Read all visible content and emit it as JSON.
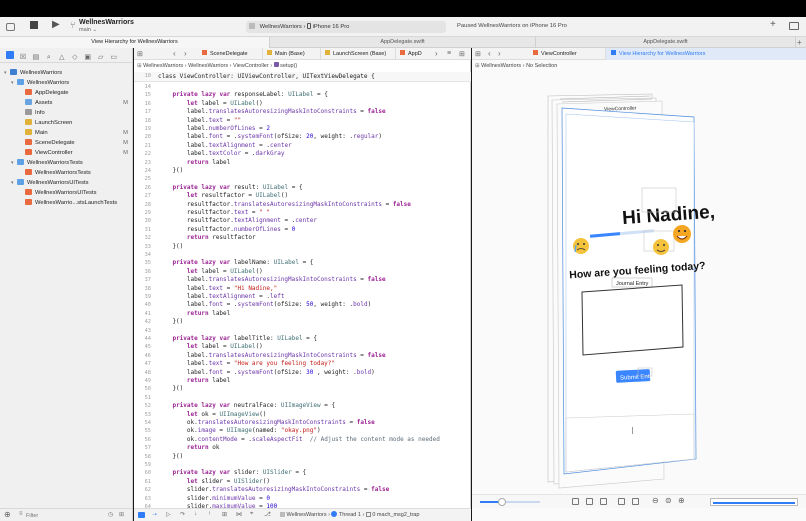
{
  "window": {
    "project_name": "WellnesWarriors",
    "branch": "main",
    "scheme": "WellnesWarriors",
    "device": "iPhone 16 Pro",
    "status": "Paused WellnesWarriors on iPhone 16 Pro"
  },
  "tabs": [
    {
      "label": "View Hierarchy for WellnesWarriors",
      "active": true
    },
    {
      "label": "AppDelegate.swift",
      "active": false
    },
    {
      "label": "AppDelegate.swift",
      "active": false
    }
  ],
  "editor_tabs": [
    "SceneDelegate",
    "Main (Base)",
    "LaunchScreen (Base)",
    "AppD"
  ],
  "canvas_tabs": [
    "ViewController",
    "View Hierarchy for WellnesWarriors"
  ],
  "navigator": {
    "items": [
      {
        "label": "WellnesWarriors",
        "level": 0,
        "kind": "proj",
        "badge": ""
      },
      {
        "label": "WellnesWarriors",
        "level": 1,
        "kind": "folder",
        "badge": ""
      },
      {
        "label": "AppDelegate",
        "level": 2,
        "kind": "swift",
        "badge": ""
      },
      {
        "label": "Assets",
        "level": 2,
        "kind": "asset",
        "badge": "M"
      },
      {
        "label": "Info",
        "level": 2,
        "kind": "plist",
        "badge": ""
      },
      {
        "label": "LaunchScreen",
        "level": 2,
        "kind": "story",
        "badge": ""
      },
      {
        "label": "Main",
        "level": 2,
        "kind": "story",
        "badge": "M"
      },
      {
        "label": "SceneDelegate",
        "level": 2,
        "kind": "swift",
        "badge": "M"
      },
      {
        "label": "ViewController",
        "level": 2,
        "kind": "swift",
        "badge": "M"
      },
      {
        "label": "WellnesWarriorsTests",
        "level": 1,
        "kind": "folder",
        "badge": ""
      },
      {
        "label": "WellnesWarriorsTests",
        "level": 2,
        "kind": "swift",
        "badge": ""
      },
      {
        "label": "WellnesWarriorsUITests",
        "level": 1,
        "kind": "folder",
        "badge": ""
      },
      {
        "label": "WellnesWarriorsUITests",
        "level": 2,
        "kind": "swift",
        "badge": ""
      },
      {
        "label": "WellnesWarrio...stsLaunchTests",
        "level": 2,
        "kind": "swift",
        "badge": ""
      }
    ],
    "filter_placeholder": "Filter"
  },
  "editor_breadcrumb": [
    "WellnesWarriors",
    "WellnesWarriors",
    "ViewController",
    "setup()"
  ],
  "canvas_breadcrumb": [
    "WellnesWarriors",
    "No Selection"
  ],
  "code_header": {
    "line": "10",
    "text": "class ViewController: UIViewController, UITextViewDelegate {"
  },
  "code_lines": [
    {
      "n": "14",
      "t": ""
    },
    {
      "n": "15",
      "t": "    private lazy var responseLabel: UILabel = {"
    },
    {
      "n": "16",
      "t": "        let label = UILabel()"
    },
    {
      "n": "17",
      "t": "        label.translatesAutoresizingMaskIntoConstraints = false"
    },
    {
      "n": "18",
      "t": "        label.text = \"\""
    },
    {
      "n": "19",
      "t": "        label.numberOfLines = 2"
    },
    {
      "n": "20",
      "t": "        label.font = .systemFont(ofSize: 20, weight: .regular)"
    },
    {
      "n": "21",
      "t": "        label.textAlignment = .center"
    },
    {
      "n": "22",
      "t": "        label.textColor = .darkGray"
    },
    {
      "n": "23",
      "t": "        return label"
    },
    {
      "n": "24",
      "t": "    }()"
    },
    {
      "n": "25",
      "t": ""
    },
    {
      "n": "26",
      "t": "    private lazy var result: UILabel = {"
    },
    {
      "n": "27",
      "t": "        let resultfactor = UILabel()"
    },
    {
      "n": "28",
      "t": "        resultfactor.translatesAutoresizingMaskIntoConstraints = false"
    },
    {
      "n": "29",
      "t": "        resultfactor.text = \" \""
    },
    {
      "n": "30",
      "t": "        resultfactor.textAlignment = .center"
    },
    {
      "n": "31",
      "t": "        resultfactor.numberOfLines = 0"
    },
    {
      "n": "32",
      "t": "        return resultfactor"
    },
    {
      "n": "33",
      "t": "    }()"
    },
    {
      "n": "34",
      "t": ""
    },
    {
      "n": "35",
      "t": "    private lazy var labelName: UILabel = {"
    },
    {
      "n": "36",
      "t": "        let label = UILabel()"
    },
    {
      "n": "37",
      "t": "        label.translatesAutoresizingMaskIntoConstraints = false"
    },
    {
      "n": "38",
      "t": "        label.text = \"Hi Nadine,\""
    },
    {
      "n": "39",
      "t": "        label.textAlignment = .left"
    },
    {
      "n": "40",
      "t": "        label.font = .systemFont(ofSize: 50, weight: .bold)"
    },
    {
      "n": "41",
      "t": "        return label"
    },
    {
      "n": "42",
      "t": "    }()"
    },
    {
      "n": "43",
      "t": ""
    },
    {
      "n": "44",
      "t": "    private lazy var labelTitle: UILabel = {"
    },
    {
      "n": "45",
      "t": "        let label = UILabel()"
    },
    {
      "n": "46",
      "t": "        label.translatesAutoresizingMaskIntoConstraints = false"
    },
    {
      "n": "47",
      "t": "        label.text = \"How are you feeling today?\""
    },
    {
      "n": "48",
      "t": "        label.font = .systemFont(ofSize: 30 , weight: .bold)"
    },
    {
      "n": "49",
      "t": "        return label"
    },
    {
      "n": "50",
      "t": "    }()"
    },
    {
      "n": "51",
      "t": ""
    },
    {
      "n": "52",
      "t": "    private lazy var neutralFace: UIImageView = {"
    },
    {
      "n": "53",
      "t": "        let ok = UIImageView()"
    },
    {
      "n": "54",
      "t": "        ok.translatesAutoresizingMaskIntoConstraints = false"
    },
    {
      "n": "55",
      "t": "        ok.image = UIImage(named: \"okay.png\")"
    },
    {
      "n": "56",
      "t": "        ok.contentMode = .scaleAspectFit  // Adjust the content mode as needed"
    },
    {
      "n": "57",
      "t": "        return ok"
    },
    {
      "n": "58",
      "t": "    }()"
    },
    {
      "n": "59",
      "t": ""
    },
    {
      "n": "60",
      "t": "    private lazy var slider: UISlider = {"
    },
    {
      "n": "61",
      "t": "        let slider = UISlider()"
    },
    {
      "n": "62",
      "t": "        slider.translatesAutoresizingMaskIntoConstraints = false"
    },
    {
      "n": "63",
      "t": "        slider.minimumValue = 0"
    },
    {
      "n": "64",
      "t": "        slider.maximumValue = 100"
    }
  ],
  "preview": {
    "root_label": "ViewController",
    "greeting": "Hi Nadine,",
    "question": "How are you feeling today?",
    "journal_label": "Journal Entry",
    "submit_label": "Submit Entr"
  },
  "debug_bar": {
    "scheme": "WellnesWarriors",
    "thread": "Thread 1",
    "frame": "0 mach_msg2_trap"
  },
  "colors": {
    "accent": "#2f7cf6",
    "keyword": "#9b2393",
    "string": "#c41a16",
    "number": "#1c00cf"
  }
}
